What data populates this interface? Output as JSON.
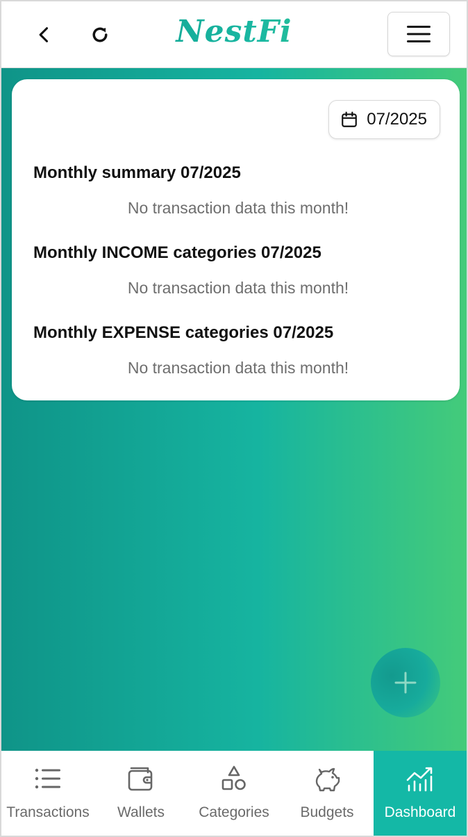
{
  "header": {
    "brand": "NestFi",
    "back_icon": "chevron-left-icon",
    "refresh_icon": "refresh-icon",
    "menu_icon": "hamburger-menu-icon"
  },
  "card": {
    "date_picker_value": "07/2025",
    "date_icon": "calendar-icon",
    "sections": [
      {
        "title": "Monthly summary 07/2025",
        "empty_text": "No transaction data this month!"
      },
      {
        "title": "Monthly INCOME categories 07/2025",
        "empty_text": "No transaction data this month!"
      },
      {
        "title": "Monthly EXPENSE categories 07/2025",
        "empty_text": "No transaction data this month!"
      }
    ]
  },
  "fab": {
    "icon": "plus-icon"
  },
  "bottom_nav": {
    "items": [
      {
        "label": "Transactions",
        "icon": "list-icon"
      },
      {
        "label": "Wallets",
        "icon": "wallet-icon"
      },
      {
        "label": "Categories",
        "icon": "shapes-icon"
      },
      {
        "label": "Budgets",
        "icon": "piggy-bank-icon"
      },
      {
        "label": "Dashboard",
        "icon": "chart-icon"
      }
    ],
    "active": "Dashboard"
  },
  "colors": {
    "brand_teal": "#14b8a6",
    "gradient_start": "#0f9488",
    "gradient_end": "#44cb7a",
    "muted_text": "#6e6e6e"
  }
}
